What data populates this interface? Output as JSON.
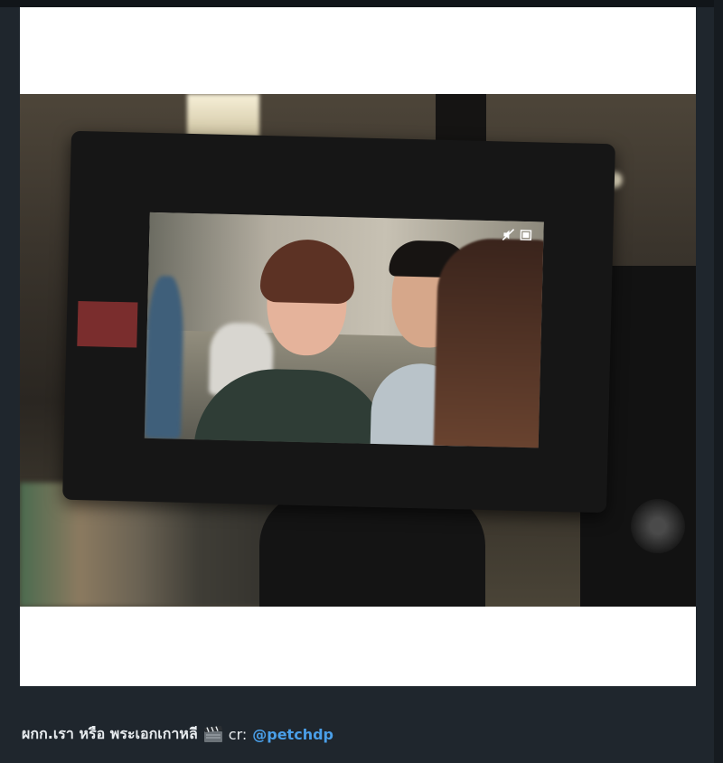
{
  "post": {
    "caption_text": "ผกก.เรา หรือ พระเอกเกาหลี",
    "caption_icon": "clapper-board-icon",
    "credit_label": "cr:",
    "credit_handle": "@petchdp"
  },
  "photo": {
    "monitor_icons": [
      "mute-icon",
      "battery-icon"
    ]
  },
  "colors": {
    "background": "#1f262d",
    "link": "#4a9fe8",
    "caption_text": "#e8ecef"
  }
}
